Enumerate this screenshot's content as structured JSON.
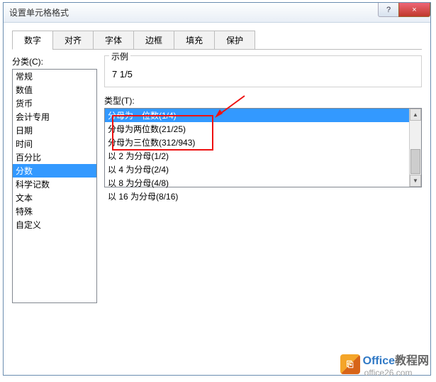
{
  "window": {
    "title": "设置单元格格式"
  },
  "controls": {
    "help": "?",
    "close": "×"
  },
  "tabs": [
    "数字",
    "对齐",
    "字体",
    "边框",
    "填充",
    "保护"
  ],
  "active_tab": 0,
  "labels": {
    "category": "分类(C):",
    "type": "类型(T):",
    "example_title": "示例"
  },
  "example": {
    "value": "7 1/5"
  },
  "categories": [
    "常规",
    "数值",
    "货币",
    "会计专用",
    "日期",
    "时间",
    "百分比",
    "分数",
    "科学记数",
    "文本",
    "特殊",
    "自定义"
  ],
  "selected_category_index": 7,
  "types": [
    "分母为一位数(1/4)",
    "分母为两位数(21/25)",
    "分母为三位数(312/943)",
    "以 2 为分母(1/2)",
    "以 4 为分母(2/4)",
    "以 8 为分母(4/8)",
    "以 16 为分母(8/16)"
  ],
  "selected_type_index": 0,
  "watermark": {
    "brand": "Office",
    "suffix": "教程网",
    "sub": "office26.com"
  }
}
